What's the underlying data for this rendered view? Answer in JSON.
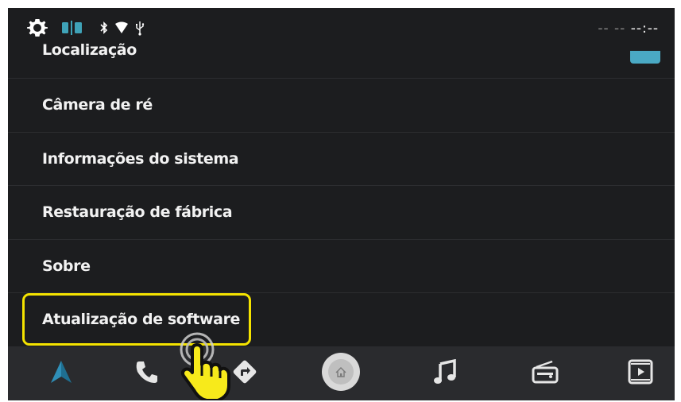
{
  "status_bar": {
    "icons": [
      "gear-icon",
      "split-screen-icon",
      "bluetooth-icon",
      "wifi-icon",
      "usb-icon"
    ],
    "clock_dim": "-- --",
    "clock_main": "--:--"
  },
  "settings": {
    "items": [
      {
        "label": "Localização",
        "has_toggle": true
      },
      {
        "label": "Câmera de ré"
      },
      {
        "label": "Informações do sistema"
      },
      {
        "label": "Restauração de fábrica"
      },
      {
        "label": "Sobre"
      },
      {
        "label": "Atualização de software",
        "highlighted": true
      }
    ]
  },
  "nav_bar": {
    "buttons": [
      "android-auto-icon",
      "phone-icon",
      "navigation-icon",
      "home-icon",
      "music-icon",
      "radio-icon",
      "video-icon"
    ]
  },
  "colors": {
    "background": "#1c1d1f",
    "nav_bar": "#2a2b2e",
    "highlight": "#f4e300",
    "toggle": "#4aa9c4",
    "split_icon": "#3fa3b8"
  }
}
